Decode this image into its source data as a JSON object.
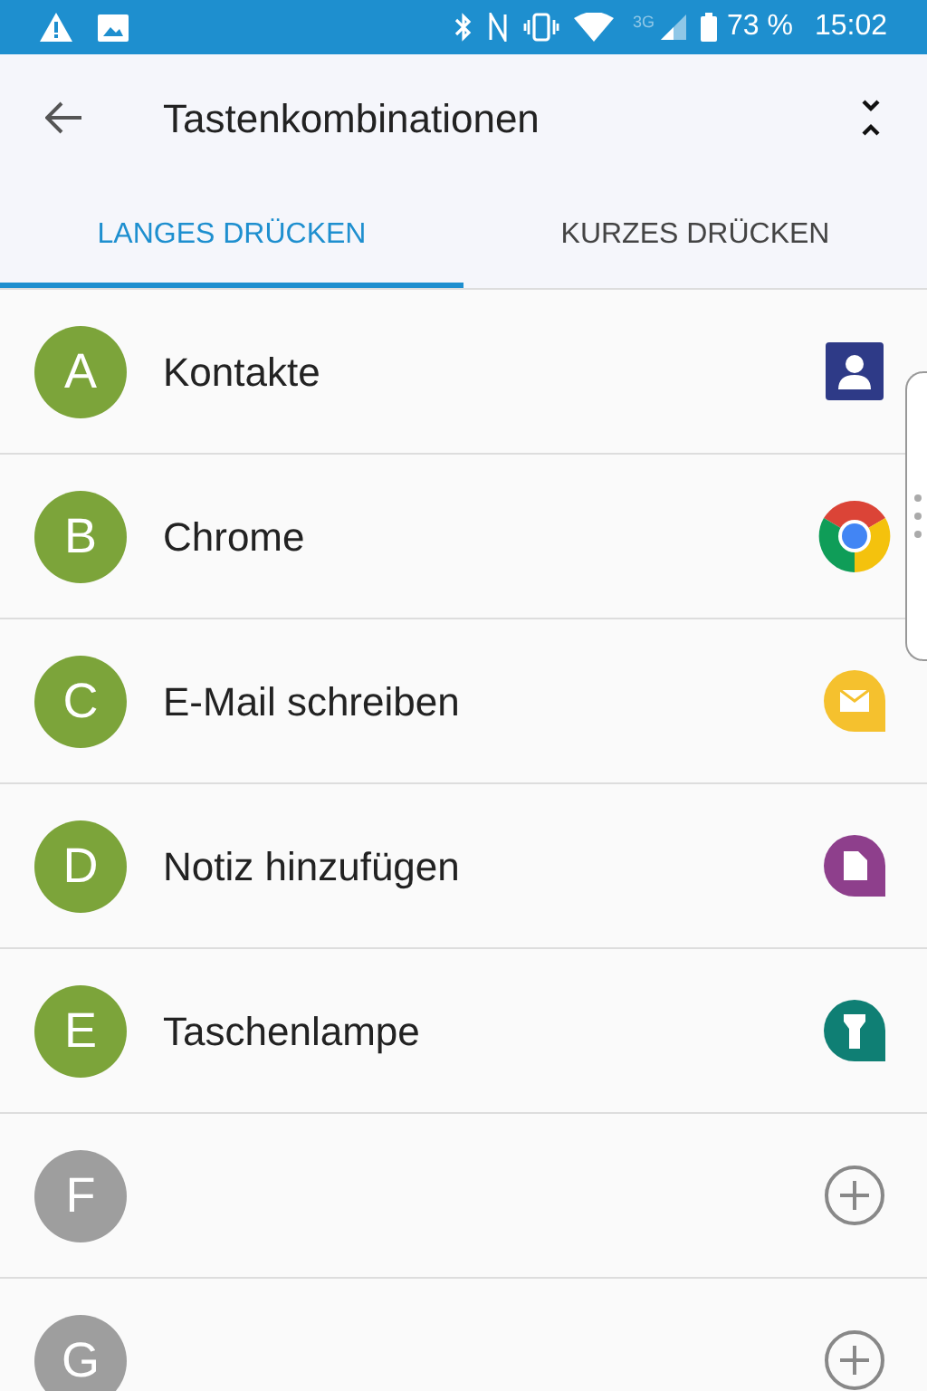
{
  "status_bar": {
    "network": "3G",
    "battery": "73 %",
    "time": "15:02"
  },
  "app_bar": {
    "title": "Tastenkombinationen"
  },
  "tabs": [
    {
      "label": "LANGES DRÜCKEN",
      "selected": true
    },
    {
      "label": "KURZES DRÜCKEN",
      "selected": false
    }
  ],
  "shortcuts": [
    {
      "letter": "A",
      "label": "Kontakte",
      "assigned": true,
      "kind": "contacts"
    },
    {
      "letter": "B",
      "label": "Chrome",
      "assigned": true,
      "kind": "chrome"
    },
    {
      "letter": "C",
      "label": "E-Mail schreiben",
      "assigned": true,
      "kind": "email"
    },
    {
      "letter": "D",
      "label": "Notiz hinzufügen",
      "assigned": true,
      "kind": "note"
    },
    {
      "letter": "E",
      "label": "Taschenlampe",
      "assigned": true,
      "kind": "flashlight"
    },
    {
      "letter": "F",
      "assigned": false,
      "kind": "add"
    },
    {
      "letter": "G",
      "assigned": false,
      "kind": "add"
    }
  ]
}
